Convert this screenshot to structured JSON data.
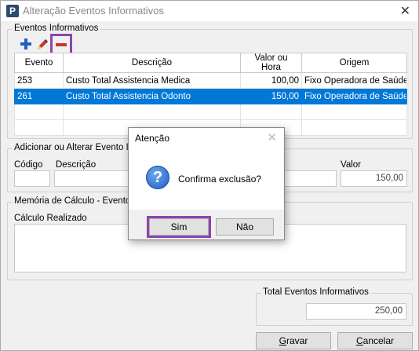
{
  "window": {
    "title": "Alteração Eventos Informativos",
    "app_icon": "P"
  },
  "eventos": {
    "legend": "Eventos Informativos",
    "toolbar": {
      "add_icon": "plus-icon",
      "edit_icon": "pencil-icon",
      "remove_icon": "minus-icon"
    },
    "columns": [
      "Evento",
      "Descrição",
      "Valor ou Hora",
      "Origem"
    ],
    "rows": [
      {
        "evento": "253",
        "descricao": "Custo Total Assistencia Medica",
        "valor": "100,00",
        "origem": "Fixo Operadora de Saúde",
        "selected": false
      },
      {
        "evento": "261",
        "descricao": "Custo Total Assistencia Odonto",
        "valor": "150,00",
        "origem": "Fixo Operadora de Saúde",
        "selected": true
      }
    ]
  },
  "adicionar": {
    "legend": "Adicionar ou Alterar Evento Info",
    "codigo_label": "Código",
    "descricao_label": "Descrição",
    "valor_label": "Valor",
    "valor_value": "150,00"
  },
  "memoria": {
    "legend": "Memória de Cálculo - Evento I",
    "calculo_label": "Cálculo Realizado"
  },
  "total": {
    "legend": "Total Eventos Informativos",
    "value": "250,00"
  },
  "buttons": {
    "gravar_pre": "",
    "gravar_u": "G",
    "gravar_post": "ravar",
    "cancelar_pre": "",
    "cancelar_u": "C",
    "cancelar_post": "ancelar"
  },
  "dialog": {
    "title": "Atenção",
    "icon": "question-icon",
    "message": "Confirma exclusão?",
    "yes_label": "Sim",
    "no_label": "Não"
  },
  "colors": {
    "selection": "#0078d7",
    "highlight": "#8e44ad",
    "add_icon": "#1e5fc6",
    "remove_icon": "#d0342c"
  }
}
